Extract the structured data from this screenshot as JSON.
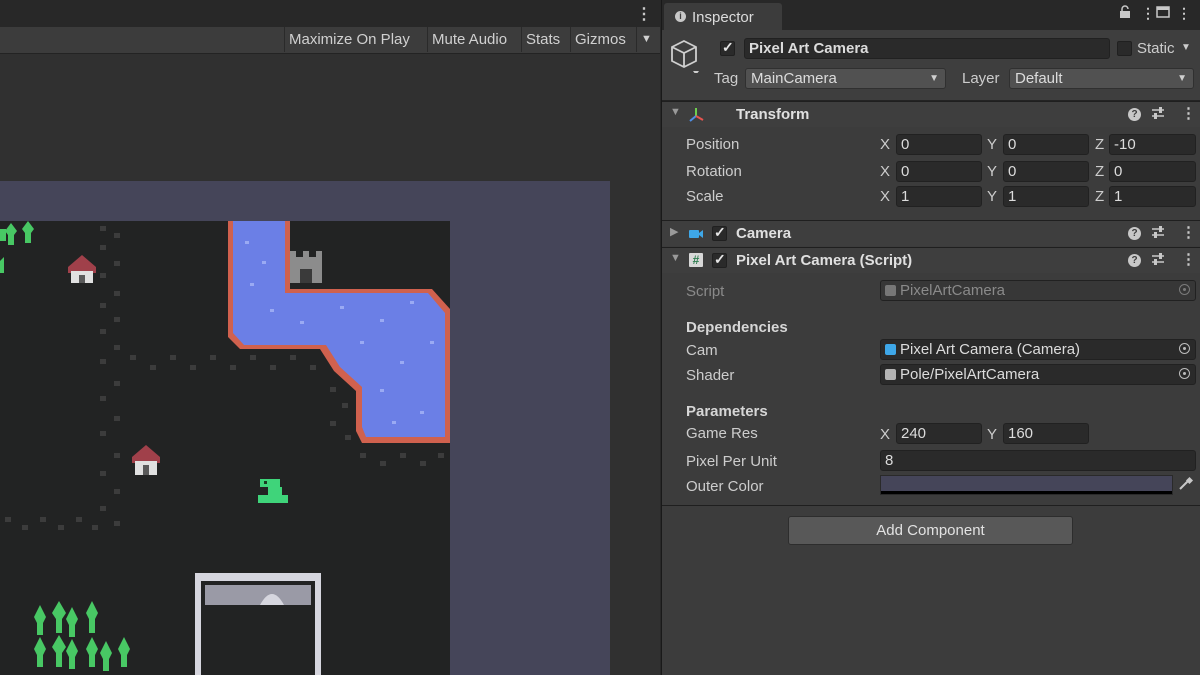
{
  "game_toolbar": {
    "maximize": "Maximize On Play",
    "mute": "Mute Audio",
    "stats": "Stats",
    "gizmos": "Gizmos"
  },
  "inspector": {
    "tab_title": "Inspector",
    "object": {
      "name": "Pixel Art Camera",
      "active": true,
      "static_label": "Static",
      "static": false,
      "tag_label": "Tag",
      "tag_value": "MainCamera",
      "layer_label": "Layer",
      "layer_value": "Default"
    },
    "transform": {
      "title": "Transform",
      "position_label": "Position",
      "rotation_label": "Rotation",
      "scale_label": "Scale",
      "axis_x": "X",
      "axis_y": "Y",
      "axis_z": "Z",
      "position": {
        "x": "0",
        "y": "0",
        "z": "-10"
      },
      "rotation": {
        "x": "0",
        "y": "0",
        "z": "0"
      },
      "scale": {
        "x": "1",
        "y": "1",
        "z": "1"
      }
    },
    "camera": {
      "title": "Camera",
      "enabled": true
    },
    "script_component": {
      "title": "Pixel Art Camera (Script)",
      "enabled": true,
      "script_label": "Script",
      "script_value": "PixelArtCamera",
      "dependencies_header": "Dependencies",
      "cam_label": "Cam",
      "cam_value": "Pixel Art Camera (Camera)",
      "shader_label": "Shader",
      "shader_value": "Pole/PixelArtCamera",
      "parameters_header": "Parameters",
      "game_res_label": "Game Res",
      "game_res_x": "240",
      "game_res_y": "160",
      "ppu_label": "Pixel Per Unit",
      "ppu_value": "8",
      "outer_color_label": "Outer Color",
      "outer_color": "#454559"
    },
    "add_component": "Add Component"
  },
  "icons": {
    "tab": "info-icon",
    "object": "gameobject-cube-icon",
    "transform": "transform-axes-icon",
    "camera": "camera-icon",
    "script": "script-hash-icon",
    "help": "help-icon",
    "presets": "presets-sliders-icon",
    "menu": "kebab-menu-icon",
    "lock": "lock-icon",
    "eyedropper": "eyedropper-icon"
  },
  "colors": {
    "water": "#6b7fe6",
    "water_edge": "#d0614e",
    "tree": "#48c864",
    "house_roof": "#a0404a",
    "snake": "#3fd47a"
  }
}
